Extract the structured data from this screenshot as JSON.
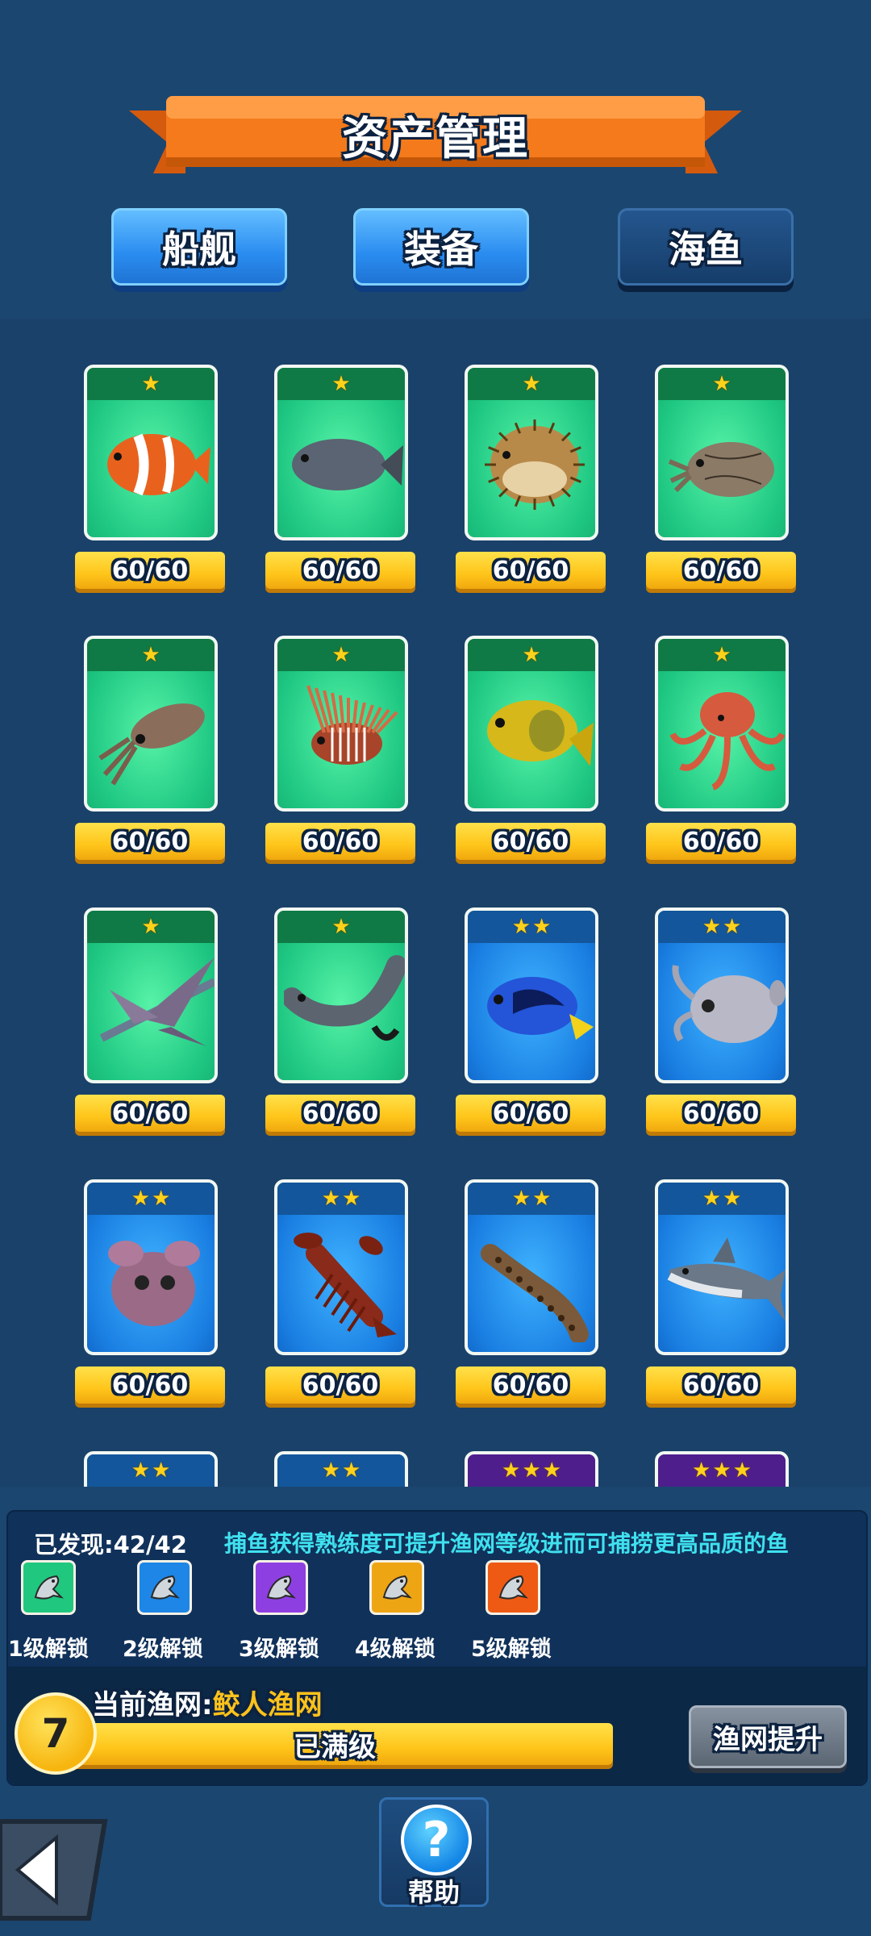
{
  "header": {
    "title": "资产管理"
  },
  "tabs": [
    {
      "label": "船舰",
      "selected": false
    },
    {
      "label": "装备",
      "selected": false
    },
    {
      "label": "海鱼",
      "selected": true
    }
  ],
  "cards": [
    {
      "stars": 1,
      "rarity": "green",
      "fish": "clownfish",
      "count": "60/60"
    },
    {
      "stars": 1,
      "rarity": "green",
      "fish": "grouper",
      "count": "60/60"
    },
    {
      "stars": 1,
      "rarity": "green",
      "fish": "pufferfish",
      "count": "60/60"
    },
    {
      "stars": 1,
      "rarity": "green",
      "fish": "cuttlefish",
      "count": "60/60"
    },
    {
      "stars": 1,
      "rarity": "green",
      "fish": "squid",
      "count": "60/60"
    },
    {
      "stars": 1,
      "rarity": "green",
      "fish": "lionfish",
      "count": "60/60"
    },
    {
      "stars": 1,
      "rarity": "green",
      "fish": "yellow-fish",
      "count": "60/60"
    },
    {
      "stars": 1,
      "rarity": "green",
      "fish": "octopus",
      "count": "60/60"
    },
    {
      "stars": 1,
      "rarity": "green",
      "fish": "flying-fish",
      "count": "60/60"
    },
    {
      "stars": 1,
      "rarity": "green",
      "fish": "catfish",
      "count": "60/60"
    },
    {
      "stars": 2,
      "rarity": "blue",
      "fish": "blue-tang",
      "count": "60/60"
    },
    {
      "stars": 2,
      "rarity": "blue",
      "fish": "dumbo-octopus",
      "count": "60/60"
    },
    {
      "stars": 2,
      "rarity": "blue",
      "fish": "flapjack-octopus",
      "count": "60/60"
    },
    {
      "stars": 2,
      "rarity": "blue",
      "fish": "lobster",
      "count": "60/60"
    },
    {
      "stars": 2,
      "rarity": "blue",
      "fish": "catshark",
      "count": "60/60"
    },
    {
      "stars": 2,
      "rarity": "blue",
      "fish": "shark",
      "count": "60/60"
    },
    {
      "stars": 2,
      "rarity": "blue",
      "fish": "",
      "count": ""
    },
    {
      "stars": 2,
      "rarity": "blue",
      "fish": "",
      "count": ""
    },
    {
      "stars": 3,
      "rarity": "purple",
      "fish": "",
      "count": ""
    },
    {
      "stars": 3,
      "rarity": "purple",
      "fish": "",
      "count": ""
    }
  ],
  "info": {
    "discovered": "已发现:42/42",
    "hint": "捕鱼获得熟练度可提升渔网等级进而可捕捞更高品质的鱼",
    "unlock_levels": [
      {
        "label": "1级解锁",
        "color": "#1fc77f"
      },
      {
        "label": "2级解锁",
        "color": "#1e86e6"
      },
      {
        "label": "3级解锁",
        "color": "#8e3fe2"
      },
      {
        "label": "4级解锁",
        "color": "#eea514"
      },
      {
        "label": "5级解锁",
        "color": "#ee5a14"
      }
    ],
    "net_level": "7",
    "current_net_label": "当前渔网:",
    "current_net_name": "鲛人渔网",
    "progress_text": "已满级",
    "progress": 1.0,
    "upgrade_label": "渔网提升"
  },
  "footer": {
    "help_label": "帮助",
    "help_icon": "?"
  },
  "colors": {
    "background": "#1b4670",
    "accent_yellow": "#ffc51a",
    "banner_orange": "#f47a1c"
  }
}
